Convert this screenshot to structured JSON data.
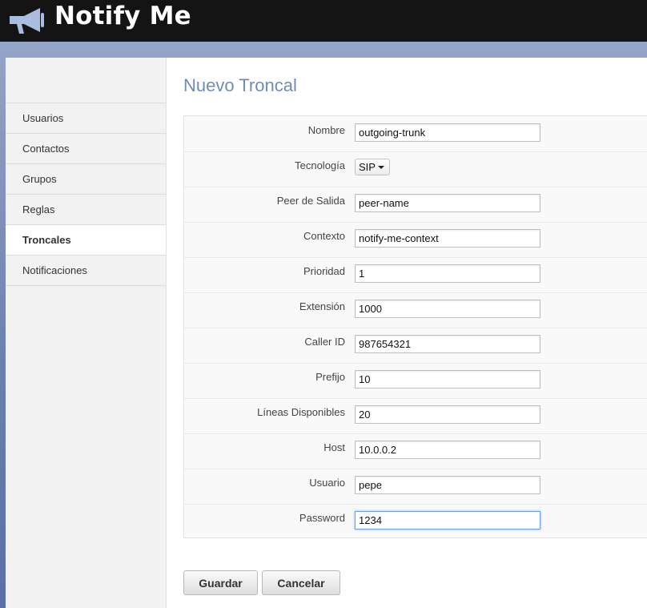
{
  "app": {
    "title": "Notify Me",
    "logo_icon": "megaphone-icon"
  },
  "sidebar": {
    "items": [
      {
        "label": "Usuarios"
      },
      {
        "label": "Contactos"
      },
      {
        "label": "Grupos"
      },
      {
        "label": "Reglas"
      },
      {
        "label": "Troncales",
        "active": true
      },
      {
        "label": "Notificaciones"
      }
    ]
  },
  "page": {
    "title": "Nuevo Troncal"
  },
  "form": {
    "nombre": {
      "label": "Nombre",
      "value": "outgoing-trunk"
    },
    "tecnologia": {
      "label": "Tecnología",
      "value": "SIP"
    },
    "peer": {
      "label": "Peer de Salida",
      "value": "peer-name"
    },
    "contexto": {
      "label": "Contexto",
      "value": "notify-me-context"
    },
    "prioridad": {
      "label": "Prioridad",
      "value": "1"
    },
    "extension": {
      "label": "Extensión",
      "value": "1000"
    },
    "caller_id": {
      "label": "Caller ID",
      "value": "987654321"
    },
    "prefijo": {
      "label": "Prefijo",
      "value": "10"
    },
    "lineas": {
      "label": "Líneas Disponibles",
      "value": "20"
    },
    "host": {
      "label": "Host",
      "value": "10.0.0.2"
    },
    "usuario": {
      "label": "Usuario",
      "value": "pepe"
    },
    "password": {
      "label": "Password",
      "value": "1234"
    }
  },
  "buttons": {
    "save": "Guardar",
    "cancel": "Cancelar"
  },
  "colors": {
    "title": "#6f8db8",
    "topbar": "#141414",
    "focus": "#6fa0e0"
  }
}
